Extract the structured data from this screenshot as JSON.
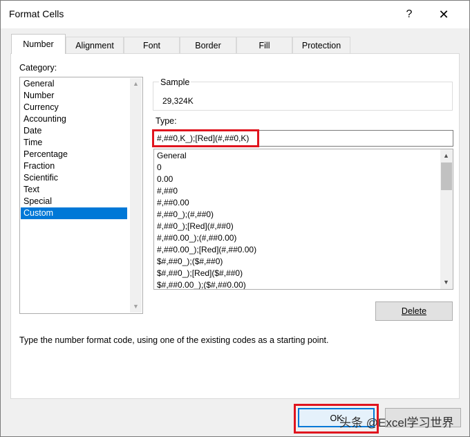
{
  "window": {
    "title": "Format Cells",
    "help": "?",
    "close": "✕"
  },
  "tabs": [
    "Number",
    "Alignment",
    "Font",
    "Border",
    "Fill",
    "Protection"
  ],
  "category": {
    "label": "Category:",
    "items": [
      "General",
      "Number",
      "Currency",
      "Accounting",
      "Date",
      "Time",
      "Percentage",
      "Fraction",
      "Scientific",
      "Text",
      "Special",
      "Custom"
    ],
    "selected": "Custom"
  },
  "sample": {
    "label": "Sample",
    "value": "29,324K"
  },
  "type": {
    "label": "Type:",
    "value": "#,##0,K_);[Red](#,##0,K)",
    "formats": [
      "General",
      "0",
      "0.00",
      "#,##0",
      "#,##0.00",
      "#,##0_);(#,##0)",
      "#,##0_);[Red](#,##0)",
      "#,##0.00_);(#,##0.00)",
      "#,##0.00_);[Red](#,##0.00)",
      "$#,##0_);($#,##0)",
      "$#,##0_);[Red]($#,##0)",
      "$#,##0.00_);($#,##0.00)"
    ]
  },
  "buttons": {
    "delete": "Delete",
    "ok": "OK",
    "cancel": ""
  },
  "description": "Type the number format code, using one of the existing codes as a starting point.",
  "watermark": "头条 @Excel学习世界",
  "colors": {
    "accent": "#0078d7",
    "highlight": "#e0141e"
  }
}
